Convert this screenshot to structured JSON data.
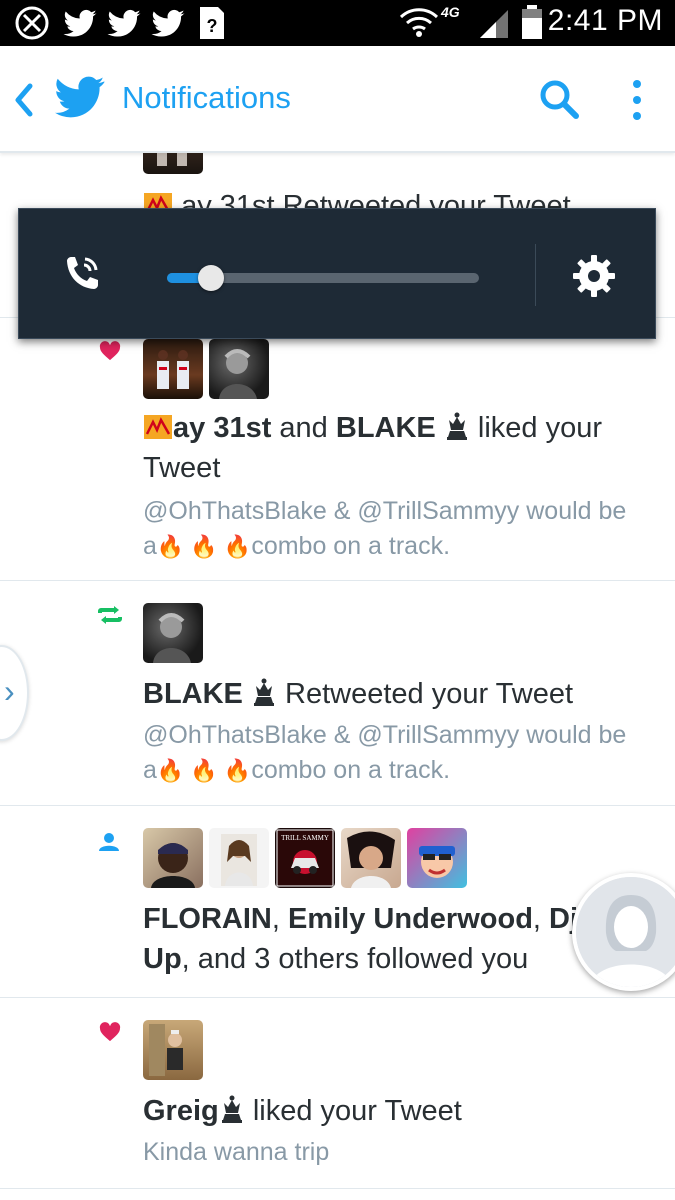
{
  "status_bar": {
    "time": "2:41 PM",
    "network": "4G",
    "icons": [
      "marvel-shield-icon",
      "twitter-icon",
      "twitter-icon",
      "twitter-icon",
      "unknown-app-icon",
      "wifi-icon",
      "signal-icon",
      "battery-icon"
    ]
  },
  "header": {
    "title": "Notifications",
    "brand_color": "#1da1f2"
  },
  "volume_panel": {
    "level": 0.14,
    "icons": [
      "phone-ring-icon",
      "gear-icon"
    ]
  },
  "notifications": [
    {
      "type": "retweet",
      "headline_partial": "ay  31st Retweeted your Tweet"
    },
    {
      "type": "like",
      "actor1": "ay  31st",
      "connector": "and",
      "actor2": "BLAKE",
      "action": "liked your Tweet",
      "tweet_line1": "@OhThatsBlake & @TrillSammyy would be",
      "tweet_prefix": "a",
      "tweet_suffix": "combo on a track."
    },
    {
      "type": "retweet",
      "actor1": "BLAKE",
      "action": "Retweeted your Tweet",
      "tweet_line1": "@OhThatsBlake & @TrillSammyy would be",
      "tweet_prefix": "a",
      "tweet_suffix": "combo on a track."
    },
    {
      "type": "follow",
      "actor1": "FLORAIN",
      "actor2": "Emily Underwood",
      "actor3_part1": "Dj T",
      "actor3_part2": "Up",
      "action": ", and 3 others followed you"
    },
    {
      "type": "like",
      "actor1": "Greig",
      "action": "liked your Tweet",
      "tweet_line1": "Kinda wanna trip"
    }
  ],
  "colors": {
    "like": "#e0245e",
    "retweet": "#17bf63",
    "follow": "#1da1f2",
    "secondary_text": "#8899a6",
    "volume_bg": "#1e2a36",
    "volume_fill": "#1e90e0"
  }
}
